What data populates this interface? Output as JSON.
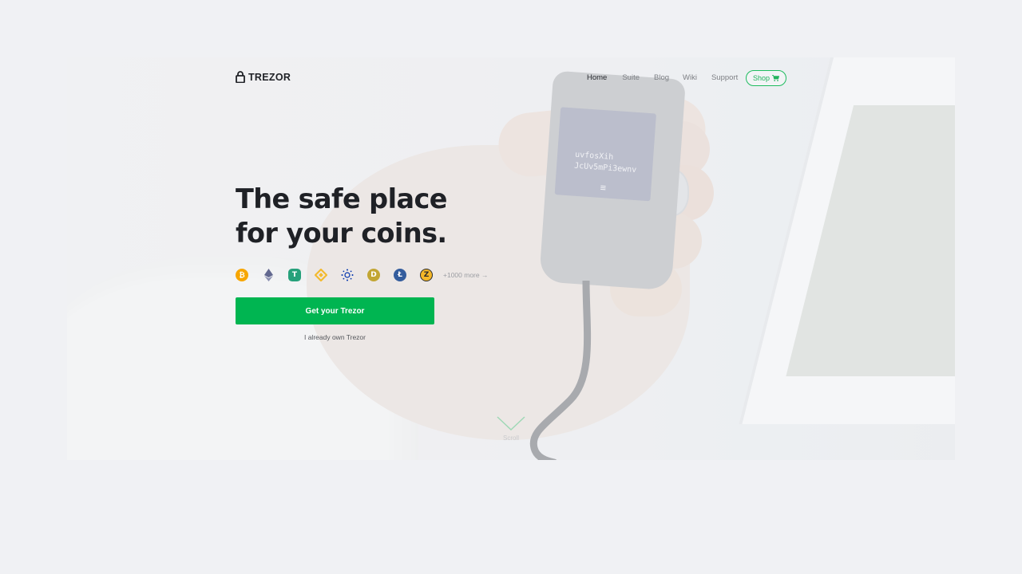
{
  "brand": {
    "name": "TREZOR"
  },
  "nav": {
    "items": [
      {
        "label": "Home",
        "active": true
      },
      {
        "label": "Suite",
        "active": false
      },
      {
        "label": "Blog",
        "active": false
      },
      {
        "label": "Wiki",
        "active": false
      },
      {
        "label": "Support",
        "active": false
      }
    ],
    "shop_label": "Shop"
  },
  "hero": {
    "headline_line1": "The safe place",
    "headline_line2": "for your coins.",
    "coins": [
      {
        "name": "bitcoin-icon",
        "color": "#f7a600"
      },
      {
        "name": "ethereum-icon",
        "color": "#62688f"
      },
      {
        "name": "tether-icon",
        "color": "#26a17b"
      },
      {
        "name": "binance-coin-icon",
        "color": "#f3ba2f"
      },
      {
        "name": "cardano-icon",
        "color": "#0033ad"
      },
      {
        "name": "dogecoin-icon",
        "color": "#c2a633"
      },
      {
        "name": "litecoin-icon",
        "color": "#345d9d"
      },
      {
        "name": "zcash-icon",
        "color": "#f4b728"
      }
    ],
    "more_coins": "+1000 more →",
    "cta_label": "Get your Trezor",
    "secondary_link": "I already own Trezor",
    "device_screen": "uvfosXih\nJcUv5mPi3ewnv",
    "scroll_label": "Scroll"
  },
  "colors": {
    "accent": "#00b551",
    "text": "#1f2126"
  }
}
